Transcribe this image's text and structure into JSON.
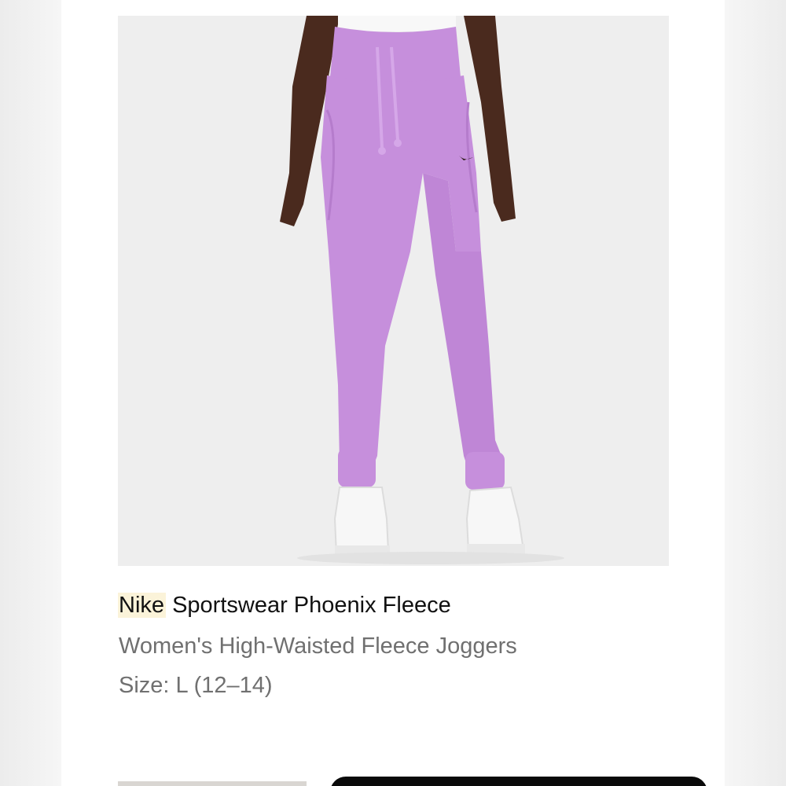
{
  "product": {
    "brand": "Nike",
    "name": " Sportswear Phoenix Fleece",
    "subtitle": "Women's High-Waisted Fleece Joggers",
    "size": "Size: L (12–14)"
  },
  "colors": {
    "garment": "#c68fdc",
    "background": "#eeeeee",
    "brand_highlight": "#fbf3d9"
  }
}
